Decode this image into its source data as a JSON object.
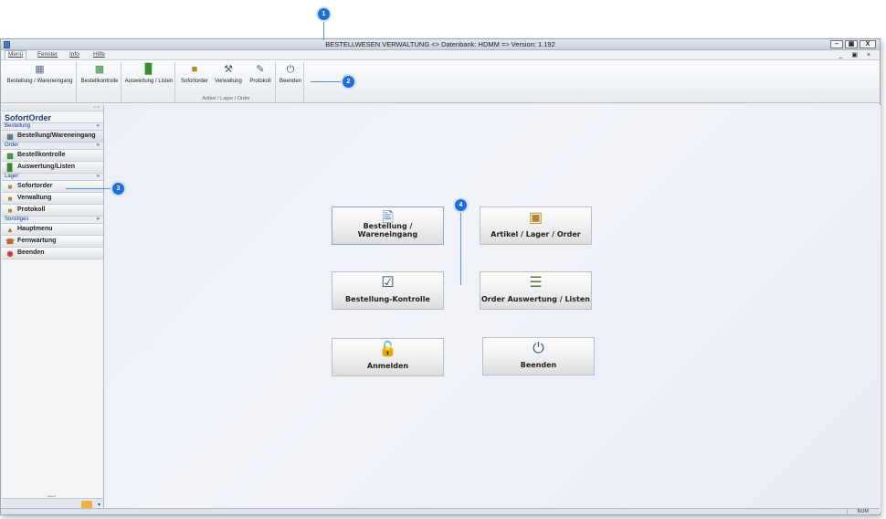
{
  "window": {
    "title": "BESTELLWESEN  VERWALTUNG <> Datenbank: HDMM => Version: 1.192",
    "controls": {
      "minimize": "–",
      "restore": "▣",
      "close": "X"
    },
    "mdi_controls": "_ ▣ ×"
  },
  "menubar": {
    "items": [
      "Menü",
      "Fenster",
      "Info",
      "Hilfe"
    ]
  },
  "ribbon": {
    "buttons": [
      {
        "label": "Bestellung / Wareneingang",
        "icon": "order-receipt-icon"
      },
      {
        "label": "Bestellkontrolle",
        "icon": "cash-control-icon"
      },
      {
        "label": "Auswertung / Listen",
        "icon": "bar-chart-icon"
      },
      {
        "label": "Sofortorder",
        "icon": "box-icon"
      },
      {
        "label": "Verwaltung",
        "icon": "gavel-icon"
      },
      {
        "label": "Protokoll",
        "icon": "edit-icon"
      },
      {
        "label": "Beenden",
        "icon": "power-icon"
      }
    ],
    "group_label": "Artikel / Lager / Order"
  },
  "sidebar": {
    "title": "SofortOrder",
    "sections": [
      {
        "name": "Bestellung",
        "items": [
          "Bestellung/Wareneingang"
        ]
      },
      {
        "name": "Order",
        "items": [
          "Bestellkontrolle",
          "Auswertung/Listen"
        ]
      },
      {
        "name": "Lager",
        "items": [
          "Sofortorder",
          "Verwaltung",
          "Protokoll"
        ]
      },
      {
        "name": "Sonstiges",
        "items": [
          "Hauptmenu",
          "Fernwartung",
          "Beenden"
        ]
      }
    ]
  },
  "tiles": [
    {
      "label": "Bestellung / Wareneingang",
      "icon": "document-icon"
    },
    {
      "label": "Artikel / Lager / Order",
      "icon": "box-icon"
    },
    {
      "label": "Bestellung-Kontrolle",
      "icon": "clipboard-check-icon"
    },
    {
      "label": "Order Auswertung / Listen",
      "icon": "list-icon"
    },
    {
      "label": "Anmelden",
      "icon": "unlock-icon"
    },
    {
      "label": "Beenden",
      "icon": "power-icon"
    }
  ],
  "callouts": [
    "1",
    "2",
    "3",
    "4"
  ],
  "statusbar": {
    "num": "NUM"
  },
  "colors": {
    "accent": "#1f6fd6",
    "sidebar_title": "#1d3f7a"
  }
}
